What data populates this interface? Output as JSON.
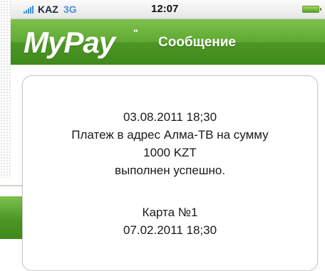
{
  "status_bar": {
    "carrier": "KAZ",
    "network": "3G",
    "time": "12:07",
    "battery_level": 1.0
  },
  "header": {
    "logo": "MyPay",
    "logo_mark": "\"",
    "title": "Сообщение"
  },
  "message": {
    "lines": [
      "03.08.2011  18;30",
      "Платеж в адрес Алма-ТВ на сумму",
      "1000 KZT",
      "выполнен успешно.",
      "Карта №1",
      "07.02.2011  18;30"
    ]
  },
  "colors": {
    "header_green": "#4c9624",
    "accent_blue": "#4e8fd6"
  }
}
